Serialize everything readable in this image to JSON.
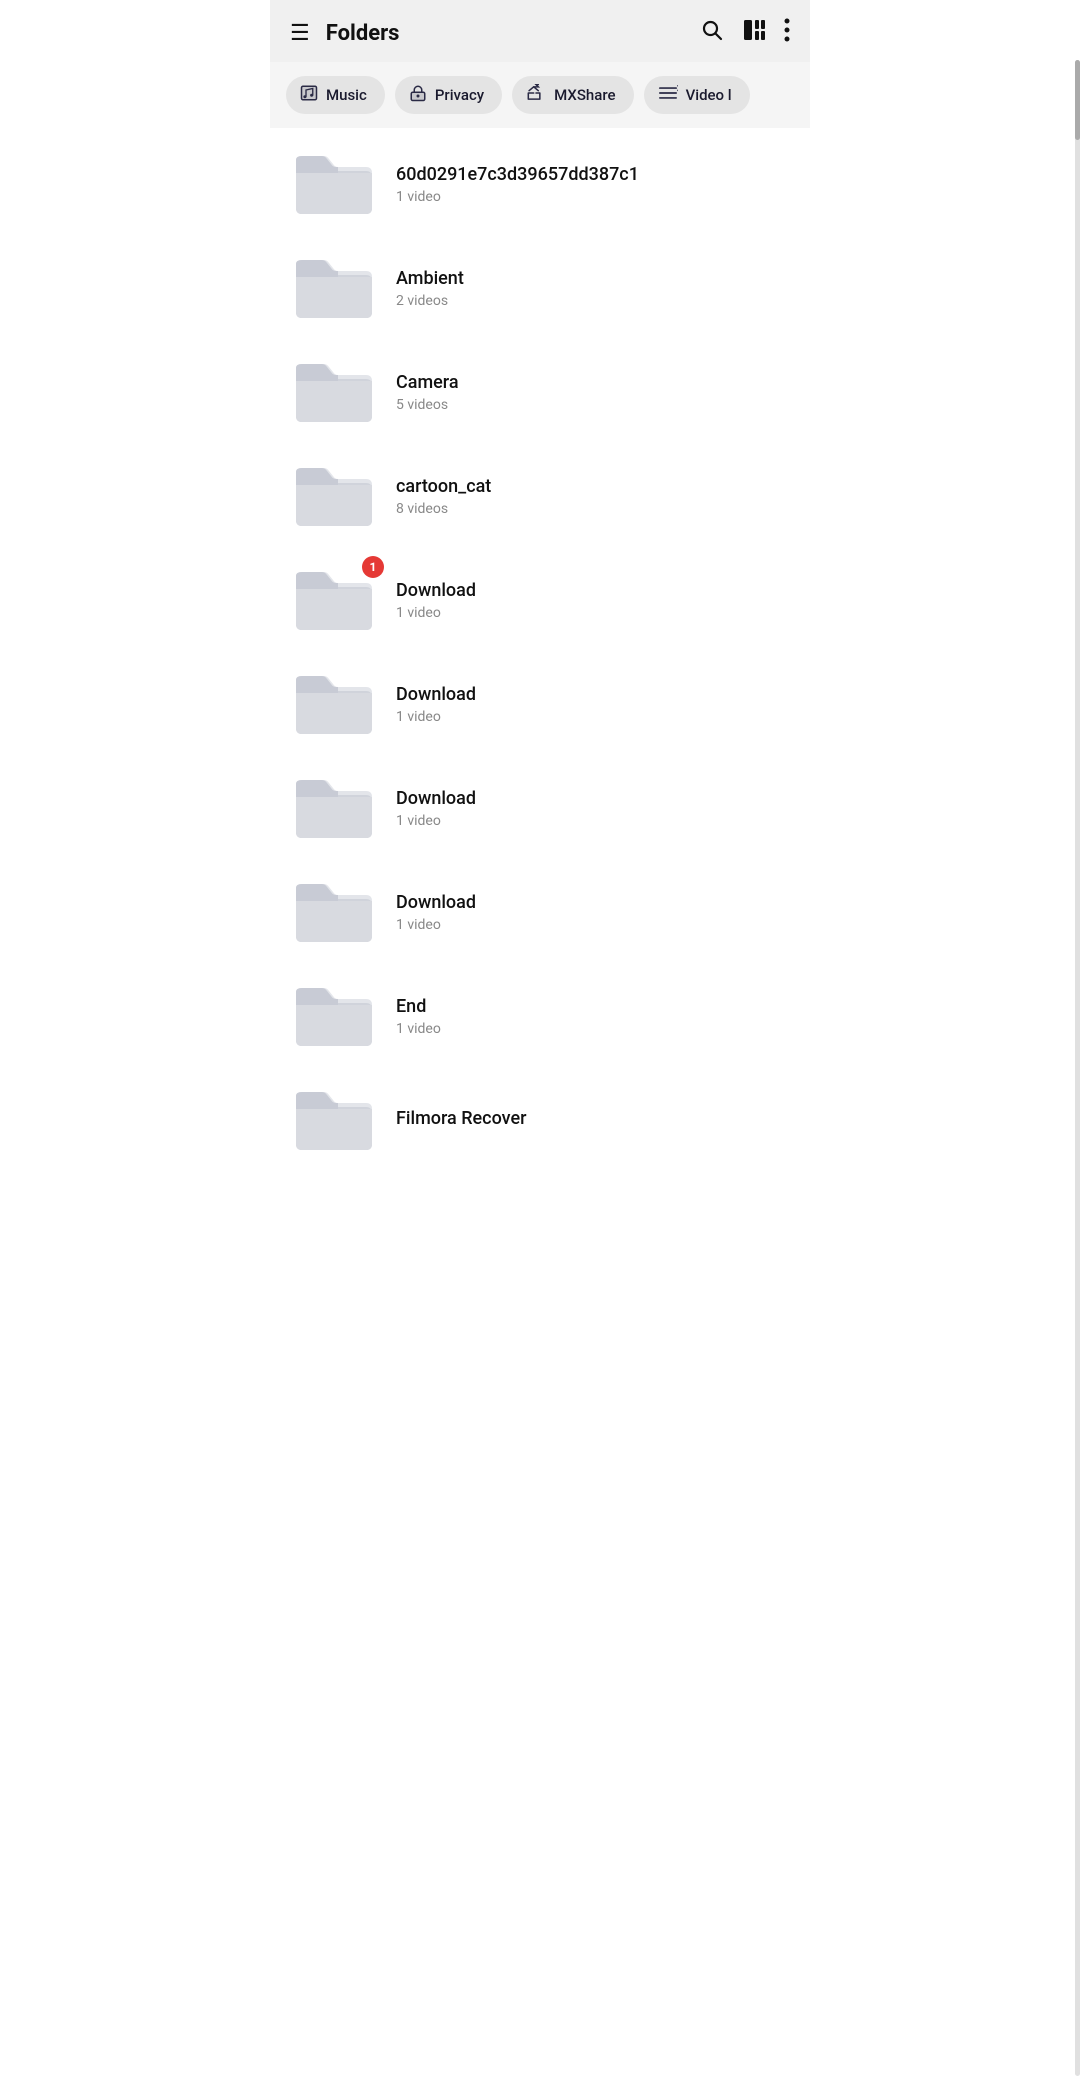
{
  "header": {
    "title": "Folders",
    "hamburger_label": "☰",
    "search_label": "search",
    "more_label": "more"
  },
  "chips": [
    {
      "id": "music",
      "icon": "🎵",
      "label": "Music"
    },
    {
      "id": "privacy",
      "icon": "🔒",
      "label": "Privacy"
    },
    {
      "id": "mxshare",
      "icon": "📤",
      "label": "MXShare"
    },
    {
      "id": "video-list",
      "icon": "📋",
      "label": "Video l"
    }
  ],
  "folders": [
    {
      "id": 1,
      "name": "60d0291e7c3d39657dd387c1",
      "count": "1 video",
      "badge": null
    },
    {
      "id": 2,
      "name": "Ambient",
      "count": "2 videos",
      "badge": null
    },
    {
      "id": 3,
      "name": "Camera",
      "count": "5 videos",
      "badge": null
    },
    {
      "id": 4,
      "name": "cartoon_cat",
      "count": "8 videos",
      "badge": null
    },
    {
      "id": 5,
      "name": "Download",
      "count": "1 video",
      "badge": "1"
    },
    {
      "id": 6,
      "name": "Download",
      "count": "1 video",
      "badge": null
    },
    {
      "id": 7,
      "name": "Download",
      "count": "1 video",
      "badge": null
    },
    {
      "id": 8,
      "name": "Download",
      "count": "1 video",
      "badge": null
    },
    {
      "id": 9,
      "name": "End",
      "count": "1 video",
      "badge": null
    },
    {
      "id": 10,
      "name": "Filmora Recover",
      "count": "",
      "badge": null
    }
  ]
}
